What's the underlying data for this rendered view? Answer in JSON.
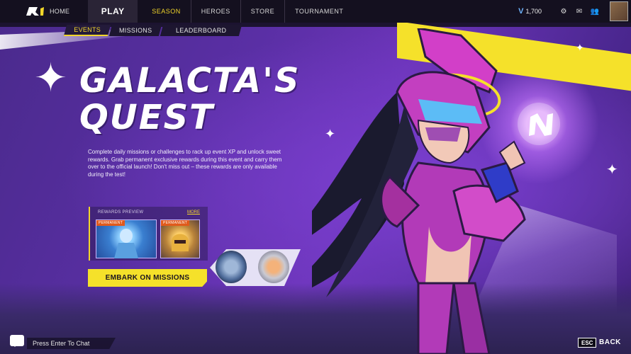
{
  "topbar": {
    "home_label": "HOME",
    "play_label": "PLAY",
    "tabs": [
      {
        "label": "SEASON",
        "active": true
      },
      {
        "label": "HEROES",
        "active": false
      },
      {
        "label": "STORE",
        "active": false
      },
      {
        "label": "TOURNAMENT",
        "active": false
      }
    ],
    "currency_value": "1,700",
    "icons": [
      "settings-gear-icon",
      "mail-icon",
      "friends-icon"
    ]
  },
  "subtabs": [
    {
      "label": "EVENTS",
      "active": true
    },
    {
      "label": "MISSIONS",
      "active": false
    },
    {
      "label": "LEADERBOARD",
      "active": false
    }
  ],
  "event": {
    "title_line1": "GALACTA'S",
    "title_line2": "QUEST",
    "description": "Complete daily missions or challenges to rack up event XP and unlock sweet rewards. Grab permanent exclusive rewards during this event and carry them over to the official launch! Don't miss out – these rewards are only available during the test!"
  },
  "rewards": {
    "label": "REWARDS PREVIEW",
    "more_label": "MORE",
    "cards": [
      {
        "badge": "PERMANENT"
      },
      {
        "badge": "PERMANENT"
      }
    ]
  },
  "embark_button": "EMBARK ON MISSIONS",
  "bottom": {
    "chat_hint": "Press Enter To Chat",
    "esc_key": "ESC",
    "back_label": "BACK"
  },
  "colors": {
    "accent": "#f5e12a",
    "nav_bg": "#14101f",
    "scene_purple": "#5a2fa5",
    "hero_magenta": "#d23fc8"
  }
}
